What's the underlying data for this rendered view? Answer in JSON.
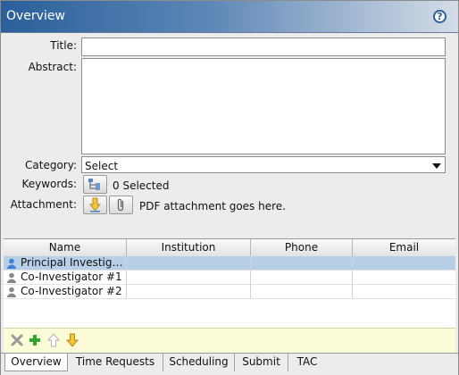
{
  "panel": {
    "title": "Overview",
    "help_glyph": "?"
  },
  "form": {
    "title_label": "Title:",
    "title_value": "",
    "abstract_label": "Abstract:",
    "abstract_value": "",
    "category_label": "Category:",
    "category_value": "Select",
    "keywords_label": "Keywords:",
    "keywords_status": "0 Selected",
    "attachment_label": "Attachment:",
    "attachment_status": "PDF attachment goes here."
  },
  "investigators_table": {
    "columns": [
      "Name",
      "Institution",
      "Phone",
      "Email"
    ],
    "rows": [
      {
        "name": "Principal Investiga...",
        "institution": "",
        "phone": "",
        "email": "",
        "icon": "person-blue-icon",
        "selected": true
      },
      {
        "name": "Co-Investigator #1",
        "institution": "",
        "phone": "",
        "email": "",
        "icon": "person-gray-icon",
        "selected": false
      },
      {
        "name": "Co-Investigator #2",
        "institution": "",
        "phone": "",
        "email": "",
        "icon": "person-gray-icon",
        "selected": false
      }
    ]
  },
  "toolbar": {
    "icons": [
      "remove-icon",
      "add-icon",
      "move-up-icon",
      "move-down-icon"
    ]
  },
  "tabs": [
    "Overview",
    "Time Requests",
    "Scheduling",
    "Submit",
    "TAC"
  ],
  "active_tab": "Overview",
  "colors": {
    "title_gradient_start": "#2a5f9a",
    "selected_row": "#b8cfe8",
    "toolbar_bg": "#fcfbd8",
    "add_green": "#2fa52f",
    "arrow_yellow": "#f2c533",
    "remove_gray": "#9a9a9a"
  }
}
